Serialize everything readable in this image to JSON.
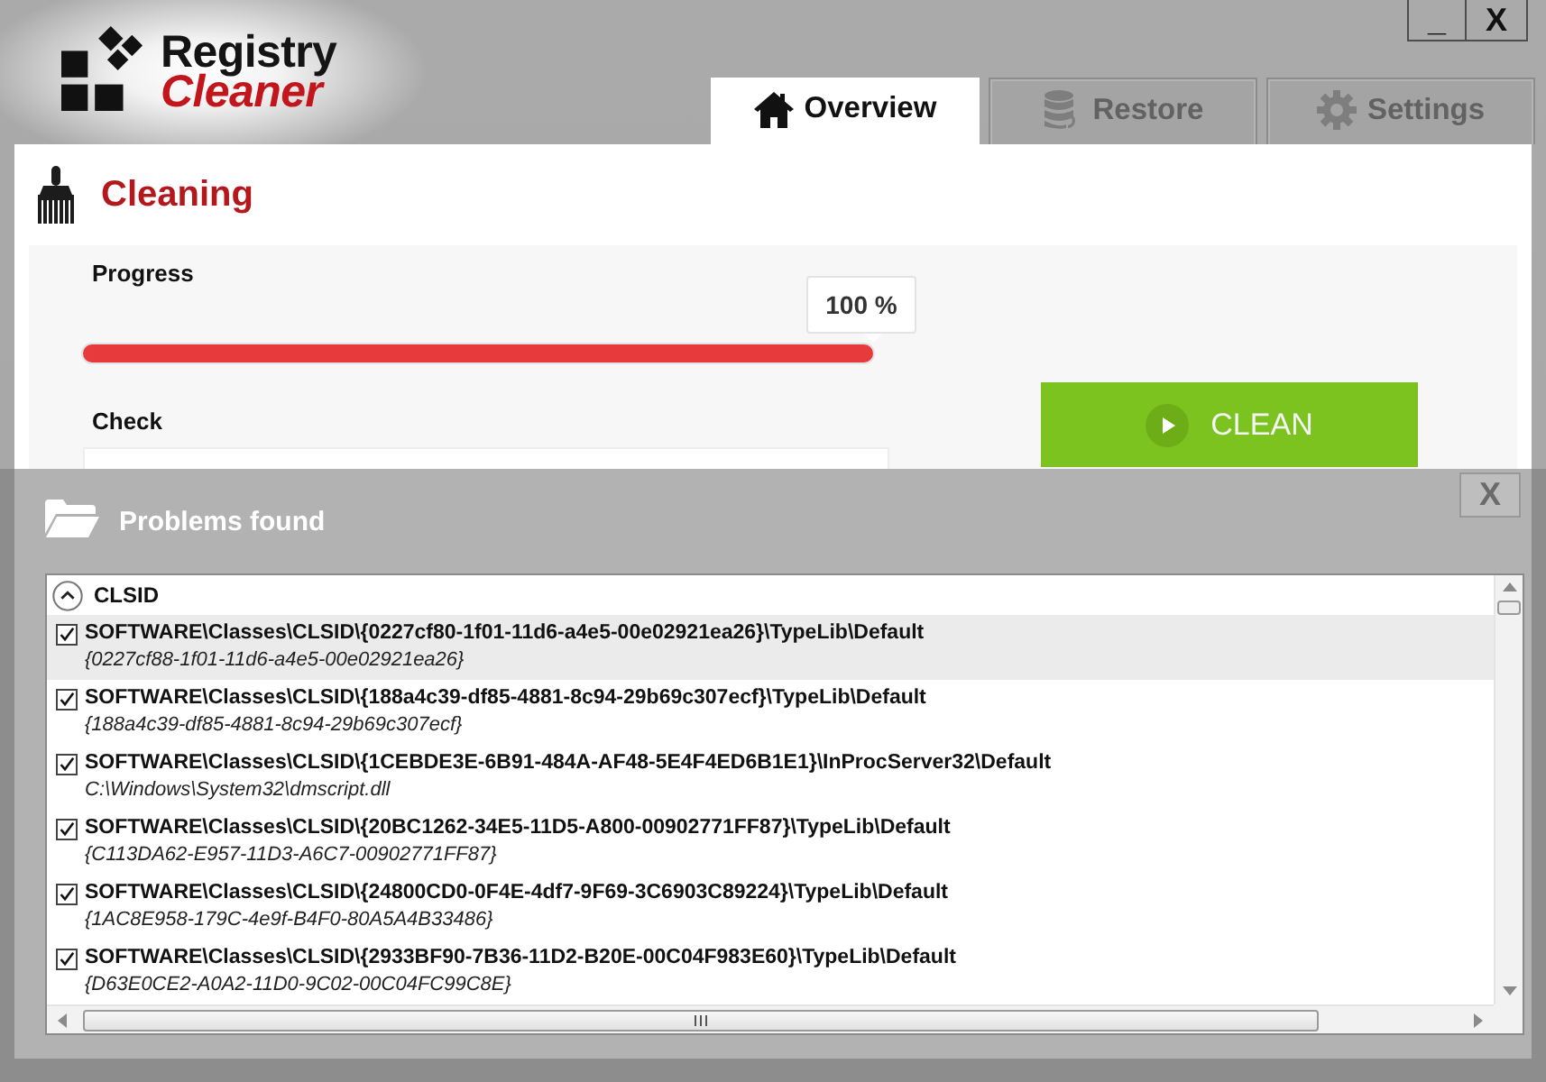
{
  "window": {
    "controls": [
      {
        "kind": "minimize",
        "label": "_"
      },
      {
        "kind": "close",
        "label": "X"
      }
    ]
  },
  "logo": {
    "line_1": "Registry",
    "line_2": "Cleaner"
  },
  "tabs": [
    {
      "kind": "overview",
      "label": "Overview",
      "selected": true
    },
    {
      "kind": "restore",
      "label": "Restore",
      "selected": false
    },
    {
      "kind": "settings",
      "label": "Settings",
      "selected": false
    }
  ],
  "cleaning": {
    "title": "Cleaning",
    "progress": {
      "label": "Progress",
      "level": 1,
      "reading": "100 %"
    },
    "check": {
      "label": "Check"
    },
    "clean_button": {
      "label": "CLEAN"
    }
  },
  "problems": {
    "title": "Problems found",
    "close_label": "X",
    "groups": [
      {
        "name": "CLSID",
        "expanded": true,
        "items": [
          {
            "path": "SOFTWARE\\Classes\\CLSID\\{0227cf80-1f01-11d6-a4e5-00e02921ea26}\\TypeLib\\Default",
            "value": "{0227cf88-1f01-11d6-a4e5-00e02921ea26}",
            "checked": true,
            "selected": true
          },
          {
            "path": "SOFTWARE\\Classes\\CLSID\\{188a4c39-df85-4881-8c94-29b69c307ecf}\\TypeLib\\Default",
            "value": "{188a4c39-df85-4881-8c94-29b69c307ecf}",
            "checked": true,
            "selected": false
          },
          {
            "path": "SOFTWARE\\Classes\\CLSID\\{1CEBDE3E-6B91-484A-AF48-5E4F4ED6B1E1}\\InProcServer32\\Default",
            "value": "C:\\Windows\\System32\\dmscript.dll",
            "checked": true,
            "selected": false
          },
          {
            "path": "SOFTWARE\\Classes\\CLSID\\{20BC1262-34E5-11D5-A800-00902771FF87}\\TypeLib\\Default",
            "value": "{C113DA62-E957-11D3-A6C7-00902771FF87}",
            "checked": true,
            "selected": false
          },
          {
            "path": "SOFTWARE\\Classes\\CLSID\\{24800CD0-0F4E-4df7-9F69-3C6903C89224}\\TypeLib\\Default",
            "value": "{1AC8E958-179C-4e9f-B4F0-80A5A4B33486}",
            "checked": true,
            "selected": false
          },
          {
            "path": "SOFTWARE\\Classes\\CLSID\\{2933BF90-7B36-11D2-B20E-00C04F983E60}\\TypeLib\\Default",
            "value": "{D63E0CE2-A0A2-11D0-9C02-00C04FC99C8E}",
            "checked": true,
            "selected": false
          }
        ]
      }
    ]
  }
}
